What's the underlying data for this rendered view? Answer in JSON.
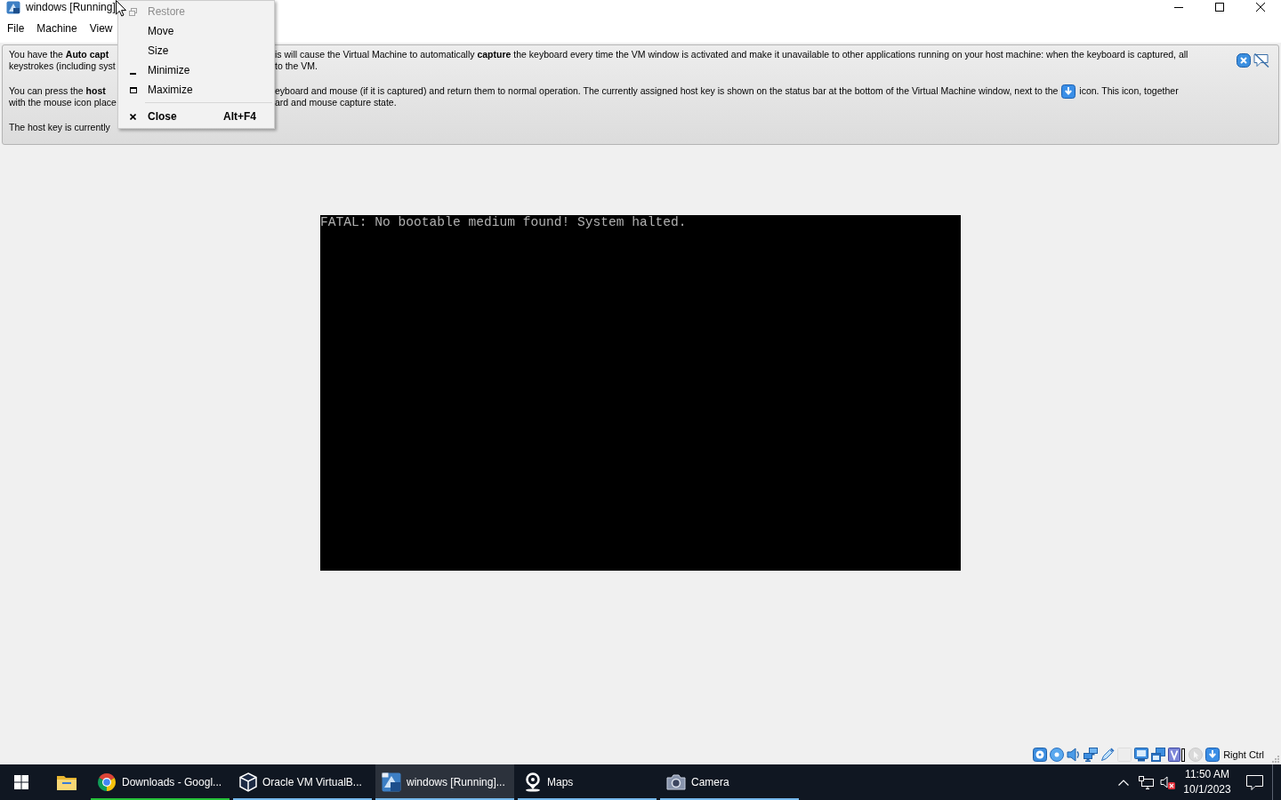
{
  "window": {
    "title": "windows [Running]",
    "menu_bar": [
      "File",
      "Machine",
      "View"
    ]
  },
  "window_menu": {
    "items": [
      {
        "label": "Restore",
        "kind": "restore",
        "disabled": true,
        "default": false,
        "separator_before": false
      },
      {
        "label": "Move",
        "kind": "plain",
        "disabled": false,
        "default": false,
        "separator_before": false
      },
      {
        "label": "Size",
        "kind": "plain",
        "disabled": false,
        "default": false,
        "separator_before": false
      },
      {
        "label": "Minimize",
        "kind": "minimize",
        "disabled": false,
        "default": false,
        "separator_before": false
      },
      {
        "label": "Maximize",
        "kind": "maximize",
        "disabled": false,
        "default": false,
        "separator_before": false
      },
      {
        "label": "Close",
        "kind": "close",
        "disabled": false,
        "default": true,
        "separator_before": true,
        "shortcut": "Alt+F4"
      }
    ]
  },
  "notification": {
    "paragraphs": [
      {
        "lines": [
          {
            "left": "You have the **Auto capt**",
            "right": "is will cause the Virtual Machine to automatically **capture** the keyboard every time the VM window is activated and make it unavailable to other applications running on your host machine: when the keyboard is captured, all"
          },
          {
            "left": "keystrokes (including syst",
            "right": "to the VM."
          }
        ]
      },
      {
        "lines": [
          {
            "left": "You can press the **host**",
            "right": "eyboard and mouse (if it is captured) and return them to normal operation. The currently assigned host key is shown on the status bar at the bottom of the Virtual Machine window, next to the",
            "after_icon": "icon. This icon, together"
          },
          {
            "left": "with the mouse icon place",
            "right": "ard and mouse capture state."
          }
        ]
      },
      {
        "lines": [
          {
            "left": "The host key is currently"
          }
        ]
      }
    ]
  },
  "vm_screen": {
    "text": "FATAL: No bootable medium found! System halted."
  },
  "status_bar": {
    "indicators": [
      {
        "kind": "hard-disk",
        "enabled": true
      },
      {
        "kind": "optical",
        "enabled": true
      },
      {
        "kind": "audio",
        "enabled": true
      },
      {
        "kind": "network",
        "enabled": true
      },
      {
        "kind": "usb",
        "enabled": true
      },
      {
        "kind": "shared-folders",
        "enabled": false
      },
      {
        "kind": "display",
        "enabled": true
      },
      {
        "kind": "recording",
        "enabled": true
      },
      {
        "kind": "features",
        "enabled": true
      },
      {
        "kind": "mouse",
        "enabled": false
      },
      {
        "kind": "keyboard",
        "enabled": true
      }
    ],
    "host_key": "Right Ctrl"
  },
  "taskbar": {
    "buttons": [
      {
        "label": "Downloads - Googl...",
        "kind": "browser",
        "selected": false,
        "level": 1
      },
      {
        "label": "Oracle VM VirtualB...",
        "kind": "manager",
        "selected": false
      },
      {
        "label": "windows [Running]...",
        "kind": "vm",
        "selected": true
      },
      {
        "label": "Maps",
        "kind": "maps",
        "selected": false
      },
      {
        "label": "Camera",
        "kind": "camera",
        "selected": false
      }
    ],
    "clock": {
      "time": "11:50 AM",
      "date": "10/1/2023"
    }
  }
}
